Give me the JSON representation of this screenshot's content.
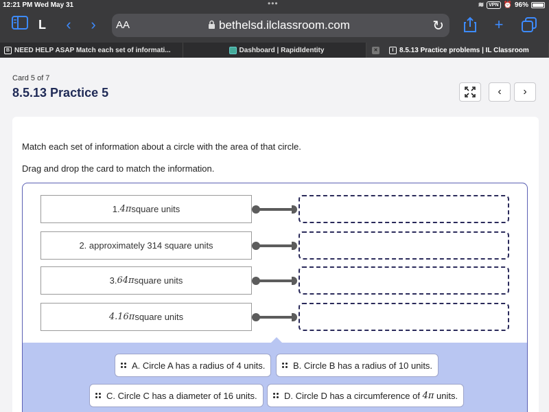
{
  "status": {
    "time": "12:21 PM",
    "date": "Wed May 31",
    "vpn": "VPN",
    "battery": "96%"
  },
  "browser": {
    "text_size": "AA",
    "url": "bethelsd.ilclassroom.com",
    "profile": "L"
  },
  "tabs": [
    {
      "label": "NEED HELP ASAP Match each set of informati..."
    },
    {
      "label": "Dashboard | RapidIdentity"
    },
    {
      "label": "8.5.13 Practice problems | IL Classroom"
    }
  ],
  "page": {
    "card_count": "Card 5 of 7",
    "title": "8.5.13 Practice 5",
    "instruction1": "Match each set of information about a circle with the area of that circle.",
    "instruction2": "Drag and drop the card to match the information."
  },
  "prompts": [
    {
      "prefix": "1. ",
      "math": "4π",
      "suffix": " square units"
    },
    {
      "prefix": "2. approximately 314 square units",
      "math": "",
      "suffix": ""
    },
    {
      "prefix": "3. ",
      "math": "64π",
      "suffix": " square units"
    },
    {
      "prefix": "",
      "math": "4.16π",
      "suffix": " square units"
    }
  ],
  "choices": [
    {
      "text": "A. Circle A has a radius of 4 units.",
      "math": ""
    },
    {
      "text": "B. Circle B has a radius of 10 units.",
      "math": ""
    },
    {
      "text": "C. Circle C has a diameter of 16 units.",
      "math": ""
    },
    {
      "text": "D. Circle D has a circumference of ",
      "math": "4π",
      "suffix": " units."
    }
  ]
}
